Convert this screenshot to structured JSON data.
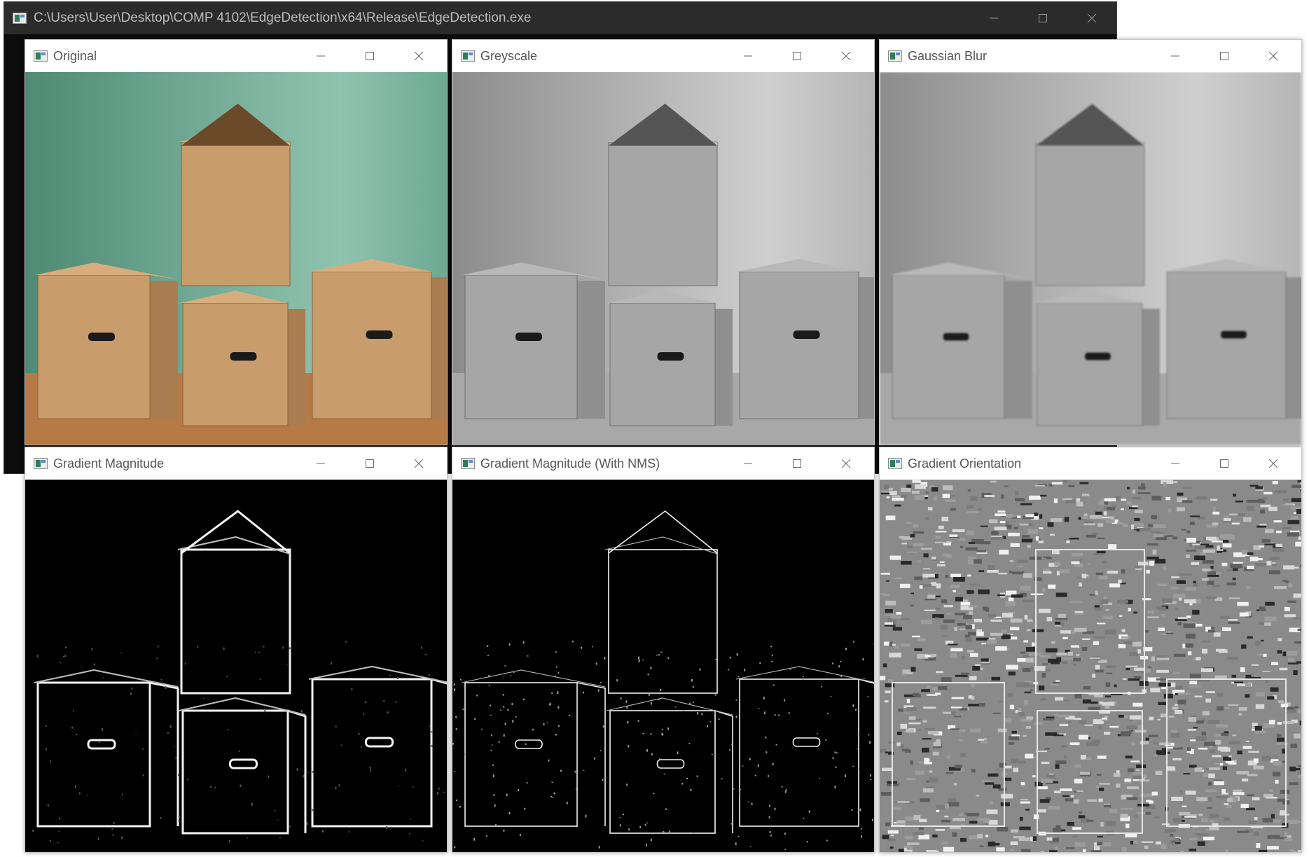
{
  "console": {
    "title": "C:\\Users\\User\\Desktop\\COMP 4102\\EdgeDetection\\x64\\Release\\EdgeDetection.exe",
    "icon": "console-app-icon",
    "minimize_icon": "minimize-icon",
    "maximize_icon": "maximize-icon",
    "close_icon": "close-icon"
  },
  "windows": [
    {
      "title": "Original",
      "view": "color-photo"
    },
    {
      "title": "Greyscale",
      "view": "greyscale-photo"
    },
    {
      "title": "Gaussian Blur",
      "view": "blurred-greyscale-photo"
    },
    {
      "title": "Gradient Magnitude",
      "view": "edge-magnitude-map"
    },
    {
      "title": "Gradient Magnitude (With NMS)",
      "view": "thin-edge-map"
    },
    {
      "title": "Gradient Orientation",
      "view": "orientation-map"
    }
  ],
  "colors": {
    "console_bg": "#0c0c0c",
    "console_titlebar": "#2b2b2b",
    "wall": "#5f9a86",
    "cardboard": "#c79a68",
    "floor": "#b57a45"
  }
}
